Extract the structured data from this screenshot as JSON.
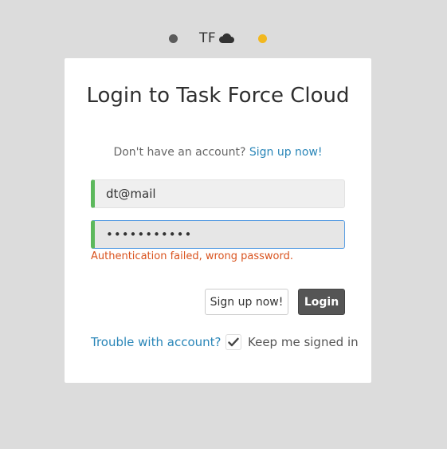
{
  "brand": {
    "logo_text": "TF",
    "logo_icon": "cloud-icon",
    "dot_left_color": "#5b5b5b",
    "dot_right_color": "#f2b81f"
  },
  "login": {
    "title": "Login to Task Force Cloud",
    "no_account_text": "Don't have an account?",
    "signup_link": "Sign up now!",
    "email_value": "dt@mail",
    "password_value": "•••••••••••",
    "error_message": "Authentication failed, wrong password.",
    "signup_button": "Sign up now!",
    "login_button": "Login",
    "trouble_link": "Trouble with account?",
    "keep_signed_in_label": "Keep me signed in",
    "keep_signed_in_checked": true
  },
  "colors": {
    "accent_valid": "#5cb85c",
    "link": "#2a86b8",
    "error": "#d9531e",
    "focus_border": "#5b9fe3"
  }
}
